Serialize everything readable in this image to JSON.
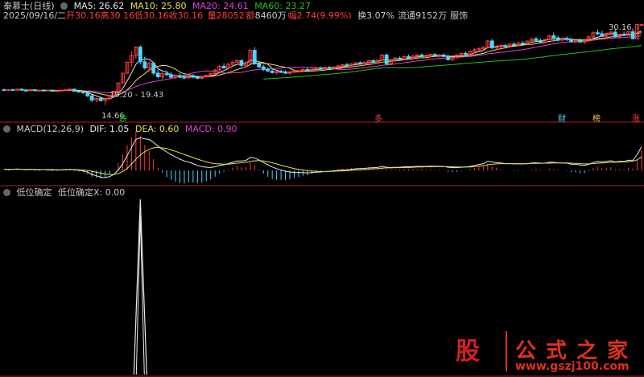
{
  "colors": {
    "up": "#ff3c3c",
    "down": "#4fd5ff",
    "ma5": "#e8e8e8",
    "ma10": "#e8e050",
    "ma20": "#e040e0",
    "ma60": "#20c020",
    "dif": "#e8e8e8",
    "dea": "#e8e050",
    "label_gray": "#c8c8c8"
  },
  "header": {
    "stock": "泰慕士(日线)",
    "ma5": "MA5: 26.62",
    "ma10": "MA10: 25.80",
    "ma20": "MA20: 24.61",
    "ma60": "MA60: 23.27",
    "date": "2025/09/16/二",
    "open_l": "开",
    "open": "30.16",
    "high_l": "高",
    "high": "30.16",
    "low_l": "低",
    "low": "30.16",
    "close_l": "收",
    "close": "30.16",
    "vol_l": "量",
    "vol": "28052",
    "amt_l": "额",
    "amt": "8460万",
    "chg_l": "幅",
    "chg": "2.74(9.99%)",
    "turn": "换3.07%",
    "float": "流通9152万",
    "industry": "服饰"
  },
  "annotations": {
    "hi": "30.16",
    "low": "14.66",
    "range": "19.20 - 19.43",
    "m_die": "跌",
    "m_duo": "多",
    "m_cai": "财",
    "m_bang": "榜",
    "m_zhang": "涨"
  },
  "macd_header": {
    "name": "MACD(12,26,9)",
    "dif": "DIF: 1.05",
    "dea": "DEA: 0.60",
    "macd": "MACD: 0.90"
  },
  "ind_header": {
    "name": "低位确定",
    "x": "低位确定X: 0.00"
  },
  "watermark": {
    "icon": "股",
    "name": "公式之家",
    "url": "www.gszj100.com"
  },
  "chart_data": {
    "type": "candlestick",
    "ylim": [
      13.5,
      31.5
    ],
    "candles": [
      [
        17.6,
        17.8,
        17.3,
        17.5
      ],
      [
        17.5,
        17.7,
        17.3,
        17.6
      ],
      [
        17.6,
        17.8,
        17.4,
        17.5
      ],
      [
        17.5,
        17.8,
        17.3,
        17.7
      ],
      [
        17.7,
        17.8,
        17.4,
        17.5
      ],
      [
        17.5,
        17.7,
        17.3,
        17.4
      ],
      [
        17.4,
        17.7,
        17.3,
        17.6
      ],
      [
        17.6,
        17.7,
        17.3,
        17.4
      ],
      [
        17.4,
        17.6,
        17.2,
        17.5
      ],
      [
        17.5,
        17.7,
        17.3,
        17.4
      ],
      [
        17.4,
        17.6,
        17.3,
        17.5
      ],
      [
        17.5,
        17.6,
        17.2,
        17.3
      ],
      [
        17.3,
        17.5,
        17.2,
        17.4
      ],
      [
        17.4,
        17.7,
        17.2,
        17.5
      ],
      [
        17.5,
        17.7,
        17.3,
        17.6
      ],
      [
        17.6,
        17.9,
        17.4,
        17.7
      ],
      [
        17.7,
        17.8,
        17.2,
        17.3
      ],
      [
        17.3,
        17.5,
        17.0,
        17.2
      ],
      [
        17.2,
        17.4,
        16.8,
        17.0
      ],
      [
        17.0,
        17.2,
        16.2,
        16.4
      ],
      [
        16.4,
        16.6,
        15.2,
        15.6
      ],
      [
        15.6,
        16.0,
        15.1,
        15.9
      ],
      [
        15.9,
        16.3,
        15.3,
        15.5
      ],
      [
        15.5,
        16.0,
        14.66,
        15.8
      ],
      [
        15.8,
        16.6,
        15.6,
        16.5
      ],
      [
        16.5,
        17.4,
        16.3,
        17.3
      ],
      [
        17.3,
        19.0,
        17.0,
        18.9
      ],
      [
        18.9,
        20.8,
        18.8,
        20.8
      ],
      [
        20.8,
        23.0,
        20.5,
        22.9
      ],
      [
        22.9,
        25.0,
        22.0,
        24.2
      ],
      [
        24.2,
        26.0,
        23.5,
        25.8
      ],
      [
        25.8,
        26.2,
        22.5,
        23.0
      ],
      [
        23.0,
        24.0,
        21.5,
        21.8
      ],
      [
        21.8,
        23.0,
        21.0,
        22.7
      ],
      [
        22.7,
        23.0,
        20.5,
        20.8
      ],
      [
        20.8,
        21.5,
        19.8,
        20.1
      ],
      [
        20.1,
        21.0,
        19.6,
        20.7
      ],
      [
        20.7,
        21.3,
        20.2,
        20.5
      ],
      [
        20.5,
        21.0,
        19.8,
        20.0
      ],
      [
        20.0,
        20.6,
        19.6,
        20.3
      ],
      [
        20.3,
        20.8,
        19.9,
        20.0
      ],
      [
        20.0,
        20.5,
        19.6,
        19.9
      ],
      [
        19.9,
        20.5,
        19.7,
        20.3
      ],
      [
        20.3,
        20.6,
        19.8,
        20.0
      ],
      [
        20.0,
        20.3,
        19.6,
        19.8
      ],
      [
        19.8,
        20.2,
        19.6,
        20.1
      ],
      [
        20.1,
        20.5,
        19.9,
        20.4
      ],
      [
        20.4,
        20.9,
        20.2,
        20.7
      ],
      [
        20.7,
        21.6,
        20.5,
        21.4
      ],
      [
        21.4,
        22.4,
        21.2,
        22.1
      ],
      [
        22.1,
        22.7,
        21.6,
        21.8
      ],
      [
        21.8,
        22.8,
        21.5,
        22.5
      ],
      [
        22.5,
        23.2,
        22.1,
        22.9
      ],
      [
        22.9,
        23.5,
        22.4,
        23.2
      ],
      [
        23.2,
        23.5,
        22.0,
        22.3
      ],
      [
        22.3,
        23.0,
        22.0,
        22.8
      ],
      [
        22.8,
        25.5,
        22.7,
        25.2
      ],
      [
        25.2,
        25.8,
        22.4,
        22.6
      ],
      [
        22.6,
        23.0,
        21.8,
        22.0
      ],
      [
        22.0,
        22.4,
        21.2,
        21.5
      ],
      [
        21.5,
        21.9,
        21.0,
        21.2
      ],
      [
        21.2,
        21.6,
        20.7,
        20.9
      ],
      [
        20.9,
        21.3,
        20.5,
        21.1
      ],
      [
        21.1,
        21.5,
        20.8,
        21.0
      ],
      [
        21.0,
        21.4,
        20.6,
        20.8
      ],
      [
        20.8,
        21.2,
        20.5,
        21.0
      ],
      [
        21.0,
        21.4,
        20.7,
        21.2
      ],
      [
        21.2,
        21.5,
        20.9,
        21.3
      ],
      [
        21.3,
        21.7,
        21.0,
        21.5
      ],
      [
        21.5,
        21.8,
        21.1,
        21.3
      ],
      [
        21.3,
        21.7,
        21.0,
        21.6
      ],
      [
        21.6,
        22.0,
        21.3,
        21.8
      ],
      [
        21.8,
        22.1,
        21.4,
        21.6
      ],
      [
        21.6,
        22.0,
        21.3,
        21.9
      ],
      [
        21.9,
        22.2,
        21.5,
        21.7
      ],
      [
        21.7,
        22.1,
        21.5,
        22.0
      ],
      [
        22.0,
        22.4,
        21.7,
        22.2
      ],
      [
        22.2,
        22.6,
        21.9,
        22.4
      ],
      [
        22.4,
        22.8,
        22.1,
        22.3
      ],
      [
        22.3,
        22.7,
        22.0,
        22.6
      ],
      [
        22.6,
        23.0,
        22.3,
        22.8
      ],
      [
        22.8,
        23.1,
        22.4,
        22.6
      ],
      [
        22.6,
        23.0,
        22.3,
        22.9
      ],
      [
        22.9,
        23.4,
        22.6,
        23.2
      ],
      [
        23.2,
        23.5,
        22.8,
        23.0
      ],
      [
        23.0,
        23.4,
        22.7,
        23.3
      ],
      [
        23.3,
        24.5,
        23.2,
        24.3
      ],
      [
        24.3,
        24.6,
        22.4,
        22.6
      ],
      [
        22.6,
        23.5,
        22.3,
        23.4
      ],
      [
        23.4,
        23.9,
        23.0,
        23.7
      ],
      [
        23.7,
        24.0,
        23.2,
        23.5
      ],
      [
        23.5,
        24.2,
        23.3,
        24.0
      ],
      [
        24.0,
        24.4,
        23.6,
        23.8
      ],
      [
        23.8,
        24.3,
        23.5,
        24.1
      ],
      [
        24.1,
        24.5,
        23.8,
        24.3
      ],
      [
        24.3,
        24.6,
        23.9,
        24.0
      ],
      [
        24.0,
        24.4,
        23.7,
        24.2
      ],
      [
        24.2,
        24.6,
        23.9,
        24.4
      ],
      [
        24.4,
        24.7,
        24.0,
        24.1
      ],
      [
        24.1,
        24.5,
        23.8,
        24.3
      ],
      [
        24.3,
        24.6,
        23.9,
        24.0
      ],
      [
        24.0,
        24.3,
        23.2,
        23.4
      ],
      [
        23.4,
        24.0,
        23.1,
        23.8
      ],
      [
        23.8,
        24.5,
        23.6,
        24.3
      ],
      [
        24.3,
        24.8,
        24.0,
        24.6
      ],
      [
        24.6,
        25.0,
        24.2,
        24.4
      ],
      [
        24.4,
        25.2,
        24.2,
        25.0
      ],
      [
        25.0,
        25.6,
        24.7,
        25.3
      ],
      [
        25.3,
        25.8,
        25.0,
        25.5
      ],
      [
        25.5,
        26.0,
        25.1,
        25.8
      ],
      [
        25.8,
        27.2,
        25.6,
        27.0
      ],
      [
        27.0,
        27.4,
        25.4,
        25.7
      ],
      [
        25.7,
        26.2,
        25.2,
        25.9
      ],
      [
        25.9,
        26.4,
        25.5,
        26.1
      ],
      [
        26.1,
        26.5,
        25.7,
        25.9
      ],
      [
        25.9,
        26.6,
        25.6,
        26.4
      ],
      [
        26.4,
        26.8,
        26.0,
        26.2
      ],
      [
        26.2,
        26.9,
        25.9,
        26.6
      ],
      [
        26.6,
        27.0,
        26.2,
        26.5
      ],
      [
        26.5,
        27.1,
        26.3,
        27.0
      ],
      [
        27.0,
        27.6,
        26.7,
        27.4
      ],
      [
        27.4,
        27.8,
        26.9,
        27.1
      ],
      [
        27.1,
        27.5,
        26.6,
        26.8
      ],
      [
        26.8,
        27.4,
        26.5,
        27.3
      ],
      [
        27.3,
        28.2,
        27.1,
        28.0
      ],
      [
        28.0,
        28.6,
        27.4,
        27.6
      ],
      [
        27.6,
        28.0,
        26.9,
        27.2
      ],
      [
        27.2,
        27.8,
        26.9,
        27.5
      ],
      [
        27.5,
        27.9,
        27.0,
        27.3
      ],
      [
        27.3,
        27.6,
        26.7,
        26.9
      ],
      [
        26.9,
        27.3,
        26.5,
        27.1
      ],
      [
        27.1,
        27.5,
        26.7,
        26.8
      ],
      [
        26.8,
        27.2,
        26.4,
        27.0
      ],
      [
        27.0,
        28.0,
        26.9,
        27.8
      ],
      [
        27.8,
        28.9,
        27.6,
        28.6
      ],
      [
        28.6,
        29.2,
        28.1,
        28.4
      ],
      [
        28.4,
        29.0,
        27.8,
        27.9
      ],
      [
        27.9,
        28.6,
        27.6,
        28.5
      ],
      [
        28.5,
        29.0,
        28.2,
        28.7
      ],
      [
        28.7,
        29.3,
        27.6,
        27.8
      ],
      [
        27.8,
        28.4,
        27.5,
        28.3
      ],
      [
        28.3,
        28.8,
        27.9,
        28.1
      ],
      [
        28.1,
        28.9,
        28.0,
        28.8
      ],
      [
        28.8,
        29.4,
        28.5,
        27.42
      ],
      [
        27.42,
        30.16,
        27.4,
        30.16
      ],
      [
        30.16,
        30.16,
        30.16,
        30.16
      ]
    ],
    "volume_note": "not shown",
    "macd": {
      "dif": [
        0.05,
        0.04,
        0.05,
        0.06,
        0.05,
        0.04,
        0.05,
        0.04,
        0.03,
        0.04,
        0.03,
        0.02,
        0.02,
        0.03,
        0.04,
        0.05,
        0.03,
        0.01,
        -0.02,
        -0.08,
        -0.18,
        -0.24,
        -0.3,
        -0.32,
        -0.28,
        -0.18,
        0.02,
        0.3,
        0.65,
        1.02,
        1.38,
        1.45,
        1.4,
        1.38,
        1.25,
        1.08,
        0.95,
        0.82,
        0.7,
        0.6,
        0.5,
        0.42,
        0.37,
        0.3,
        0.22,
        0.17,
        0.14,
        0.13,
        0.16,
        0.22,
        0.25,
        0.3,
        0.36,
        0.42,
        0.42,
        0.44,
        0.58,
        0.55,
        0.46,
        0.35,
        0.25,
        0.15,
        0.08,
        0.02,
        -0.04,
        -0.07,
        -0.09,
        -0.1,
        -0.1,
        -0.11,
        -0.1,
        -0.08,
        -0.07,
        -0.05,
        -0.04,
        -0.02,
        0.0,
        0.02,
        0.03,
        0.05,
        0.07,
        0.08,
        0.09,
        0.11,
        0.12,
        0.13,
        0.18,
        0.14,
        0.13,
        0.14,
        0.14,
        0.16,
        0.16,
        0.17,
        0.18,
        0.18,
        0.18,
        0.19,
        0.19,
        0.19,
        0.18,
        0.14,
        0.12,
        0.12,
        0.14,
        0.15,
        0.18,
        0.22,
        0.26,
        0.3,
        0.4,
        0.38,
        0.35,
        0.33,
        0.3,
        0.3,
        0.29,
        0.29,
        0.29,
        0.3,
        0.33,
        0.34,
        0.32,
        0.32,
        0.36,
        0.36,
        0.34,
        0.33,
        0.32,
        0.28,
        0.27,
        0.24,
        0.23,
        0.27,
        0.35,
        0.4,
        0.38,
        0.4,
        0.43,
        0.38,
        0.4,
        0.4,
        0.45,
        0.45,
        0.7,
        1.05
      ],
      "dea": [
        0.05,
        0.05,
        0.05,
        0.05,
        0.05,
        0.05,
        0.05,
        0.05,
        0.04,
        0.04,
        0.04,
        0.04,
        0.03,
        0.03,
        0.03,
        0.04,
        0.04,
        0.03,
        0.02,
        0.0,
        -0.04,
        -0.08,
        -0.12,
        -0.16,
        -0.18,
        -0.18,
        -0.14,
        -0.05,
        0.09,
        0.28,
        0.5,
        0.69,
        0.83,
        0.94,
        1.0,
        1.02,
        1.0,
        0.97,
        0.91,
        0.85,
        0.78,
        0.71,
        0.64,
        0.57,
        0.5,
        0.44,
        0.38,
        0.33,
        0.3,
        0.29,
        0.28,
        0.28,
        0.3,
        0.32,
        0.34,
        0.36,
        0.4,
        0.43,
        0.44,
        0.42,
        0.39,
        0.34,
        0.29,
        0.23,
        0.18,
        0.13,
        0.08,
        0.05,
        0.02,
        -0.01,
        -0.03,
        -0.04,
        -0.05,
        -0.05,
        -0.05,
        -0.04,
        -0.03,
        -0.02,
        -0.01,
        0.0,
        0.02,
        0.03,
        0.04,
        0.06,
        0.07,
        0.08,
        0.1,
        0.11,
        0.11,
        0.12,
        0.12,
        0.13,
        0.13,
        0.14,
        0.15,
        0.15,
        0.16,
        0.16,
        0.17,
        0.17,
        0.17,
        0.17,
        0.16,
        0.15,
        0.15,
        0.15,
        0.15,
        0.17,
        0.19,
        0.21,
        0.25,
        0.28,
        0.29,
        0.3,
        0.3,
        0.3,
        0.3,
        0.3,
        0.3,
        0.3,
        0.31,
        0.31,
        0.31,
        0.32,
        0.32,
        0.33,
        0.33,
        0.33,
        0.33,
        0.32,
        0.31,
        0.3,
        0.29,
        0.29,
        0.3,
        0.32,
        0.33,
        0.34,
        0.36,
        0.36,
        0.37,
        0.38,
        0.39,
        0.41,
        0.47,
        0.6
      ]
    },
    "indicator": {
      "peak_index": 31,
      "peak_value": 1.0
    }
  }
}
